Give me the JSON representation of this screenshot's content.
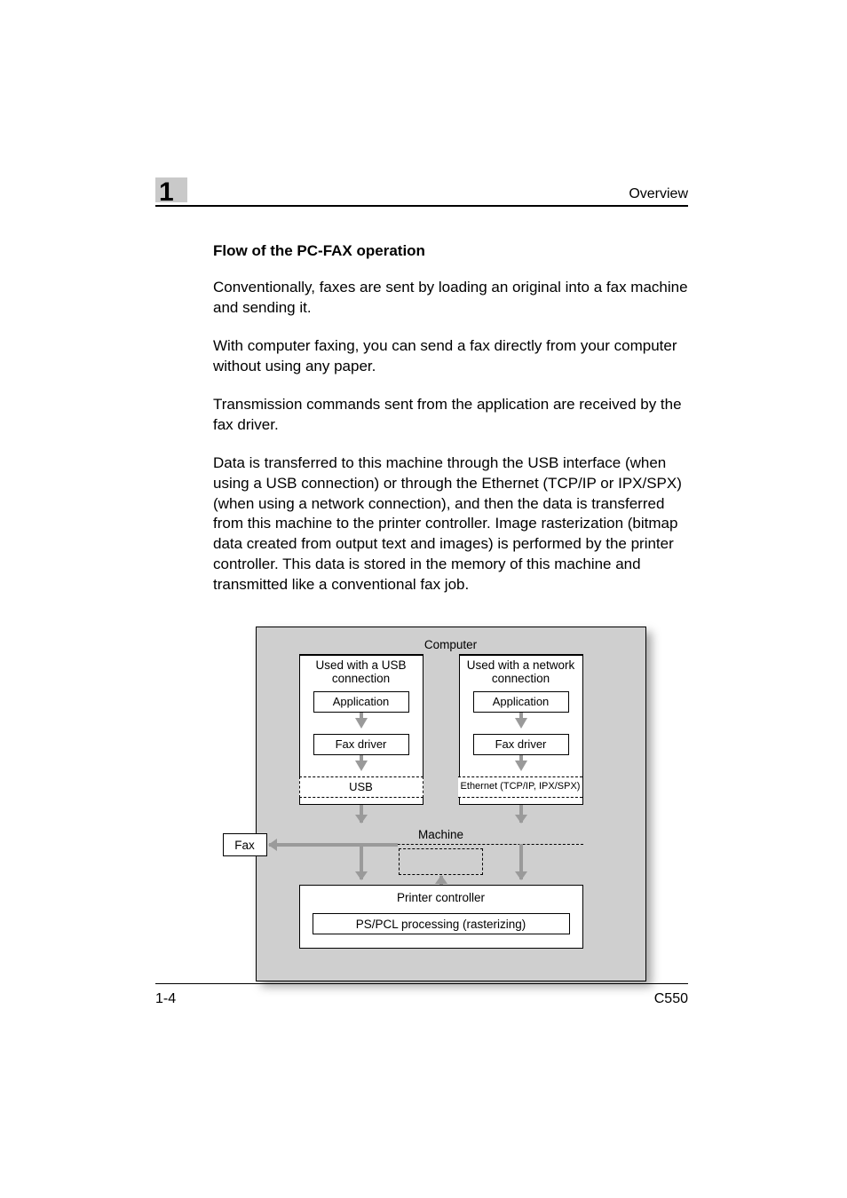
{
  "header": {
    "chapter_number": "1",
    "title": "Overview"
  },
  "section_heading": "Flow of the PC-FAX operation",
  "paragraphs": [
    "Conventionally, faxes are sent by loading an original into a fax machine and sending it.",
    "With computer faxing, you can send a fax directly from your computer without using any paper.",
    "Transmission commands sent from the application are received by the fax driver.",
    "Data is transferred to this machine through the USB interface (when using a USB connection) or through the Ethernet (TCP/IP or IPX/SPX) (when using a network connection), and then the data is transferred from this machine to the printer controller. Image rasterization (bitmap data created from output text and images) is performed by the printer controller. This data is stored in the memory of this machine and transmitted like a conventional fax job."
  ],
  "diagram": {
    "top": "Computer",
    "left": {
      "head": "Used with a USB connection",
      "box1": "Application",
      "box2": "Fax driver",
      "box3": "USB"
    },
    "right": {
      "head": "Used with a network connection",
      "box1": "Application",
      "box2": "Fax driver",
      "box3": "Ethernet (TCP/IP, IPX/SPX)"
    },
    "machine": "Machine",
    "fax": "Fax",
    "controller": "Printer controller",
    "processing": "PS/PCL processing (rasterizing)"
  },
  "footer": {
    "page": "1-4",
    "model": "C550"
  }
}
